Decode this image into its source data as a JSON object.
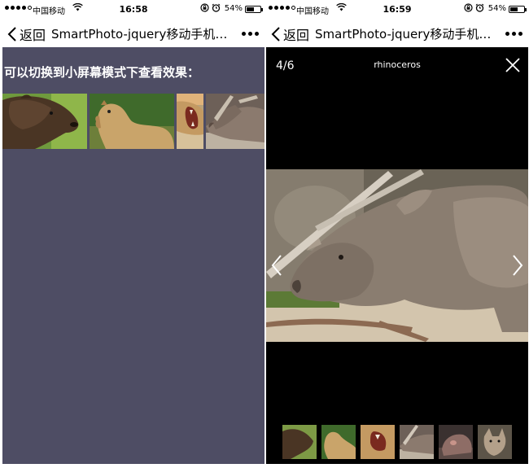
{
  "left_phone": {
    "status": {
      "carrier": "中国移动",
      "time": "16:58",
      "battery": "54%"
    },
    "nav": {
      "back_label": "返回",
      "title": "SmartPhoto-jquery移动手机…"
    },
    "heading": "可以切换到小屏幕模式下查看效果：",
    "thumbnails": [
      {
        "name": "bear"
      },
      {
        "name": "camel"
      },
      {
        "name": "lion"
      },
      {
        "name": "rhinoceros"
      }
    ]
  },
  "right_phone": {
    "status": {
      "carrier": "中国移动",
      "time": "16:59",
      "battery": "54%"
    },
    "nav": {
      "back_label": "返回",
      "title": "SmartPhoto-jquery移动手机…"
    },
    "viewer": {
      "counter": "4/6",
      "caption": "rhinoceros",
      "nav_thumbnails": [
        {
          "name": "bear"
        },
        {
          "name": "camel"
        },
        {
          "name": "lion"
        },
        {
          "name": "rhinoceros"
        },
        {
          "name": "hippo"
        },
        {
          "name": "fox"
        }
      ]
    }
  },
  "colors": {
    "left_background": "#4e4d64",
    "viewer_background": "#000000",
    "text_light": "#ffffff"
  }
}
